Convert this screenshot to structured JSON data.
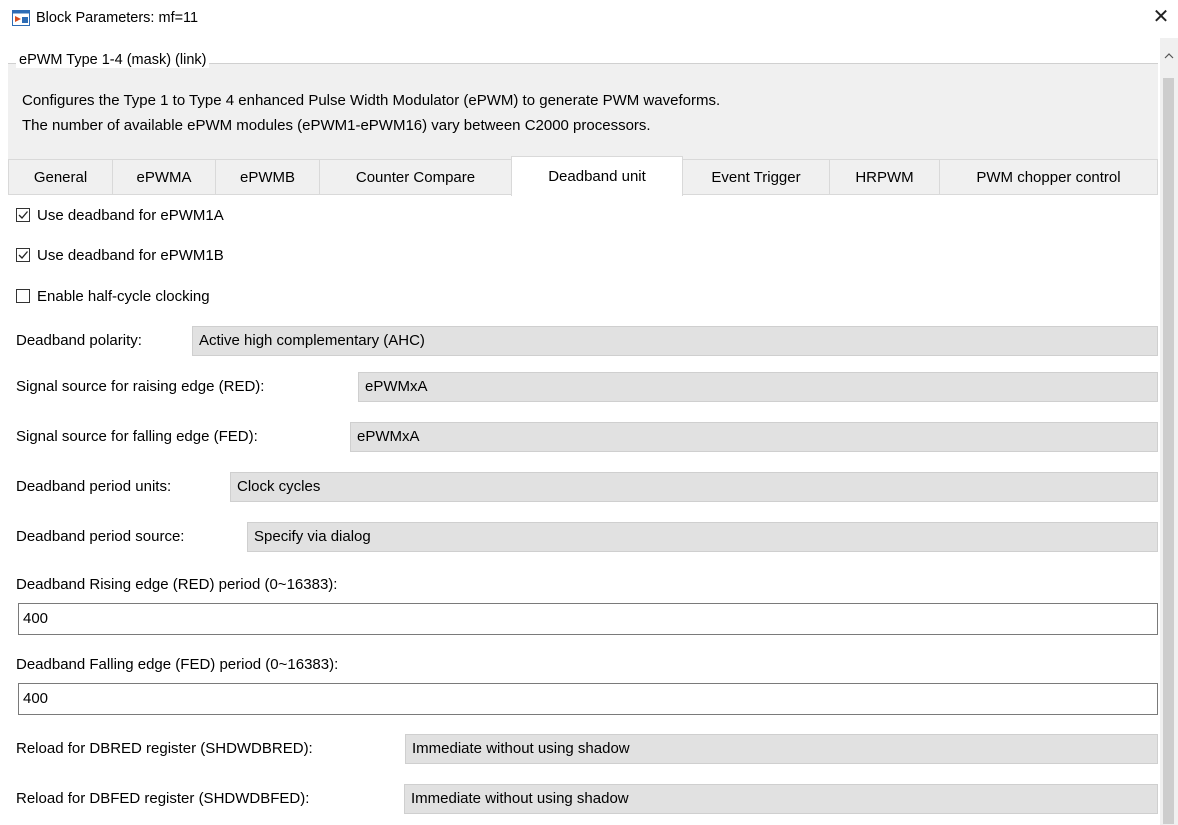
{
  "window": {
    "title": "Block Parameters: mf=11",
    "close_glyph": "✕"
  },
  "mask": {
    "group_title": "ePWM Type 1-4 (mask) (link)",
    "description_line1": "Configures the Type 1 to Type 4 enhanced Pulse Width Modulator (ePWM) to generate PWM waveforms.",
    "description_line2": "The number of available ePWM modules (ePWM1-ePWM16) vary between C2000 processors."
  },
  "tabs": [
    {
      "label": "General"
    },
    {
      "label": "ePWMA"
    },
    {
      "label": "ePWMB"
    },
    {
      "label": "Counter Compare"
    },
    {
      "label": "Deadband unit",
      "active": true
    },
    {
      "label": "Event Trigger"
    },
    {
      "label": "HRPWM"
    },
    {
      "label": "PWM chopper control"
    }
  ],
  "checkboxes": [
    {
      "label": "Use deadband for ePWM1A",
      "checked": true
    },
    {
      "label": "Use deadband for ePWM1B",
      "checked": true
    },
    {
      "label": "Enable half-cycle clocking",
      "checked": false
    }
  ],
  "params": [
    {
      "label": "Deadband polarity:",
      "value": "Active high complementary (AHC)"
    },
    {
      "label": "Signal source for raising edge (RED):",
      "value": "ePWMxA"
    },
    {
      "label": "Signal source for falling edge (FED):",
      "value": "ePWMxA"
    },
    {
      "label": "Deadband period units:",
      "value": "Clock cycles"
    },
    {
      "label": "Deadband period source:",
      "value": "Specify via dialog"
    }
  ],
  "fields": [
    {
      "label": "Deadband Rising edge (RED) period (0~16383):",
      "value": "400"
    },
    {
      "label": "Deadband Falling edge (FED) period (0~16383):",
      "value": "400"
    }
  ],
  "reload_params": [
    {
      "label": "Reload for DBRED register (SHDWDBRED):",
      "value": "Immediate without using shadow"
    },
    {
      "label": "Reload for DBFED register (SHDWDBFED):",
      "value": "Immediate without using shadow"
    }
  ],
  "icons": {
    "app": "simulink-block-icon",
    "close": "close-icon",
    "scroll_up": "chevron-up-icon",
    "check": "check-icon"
  }
}
